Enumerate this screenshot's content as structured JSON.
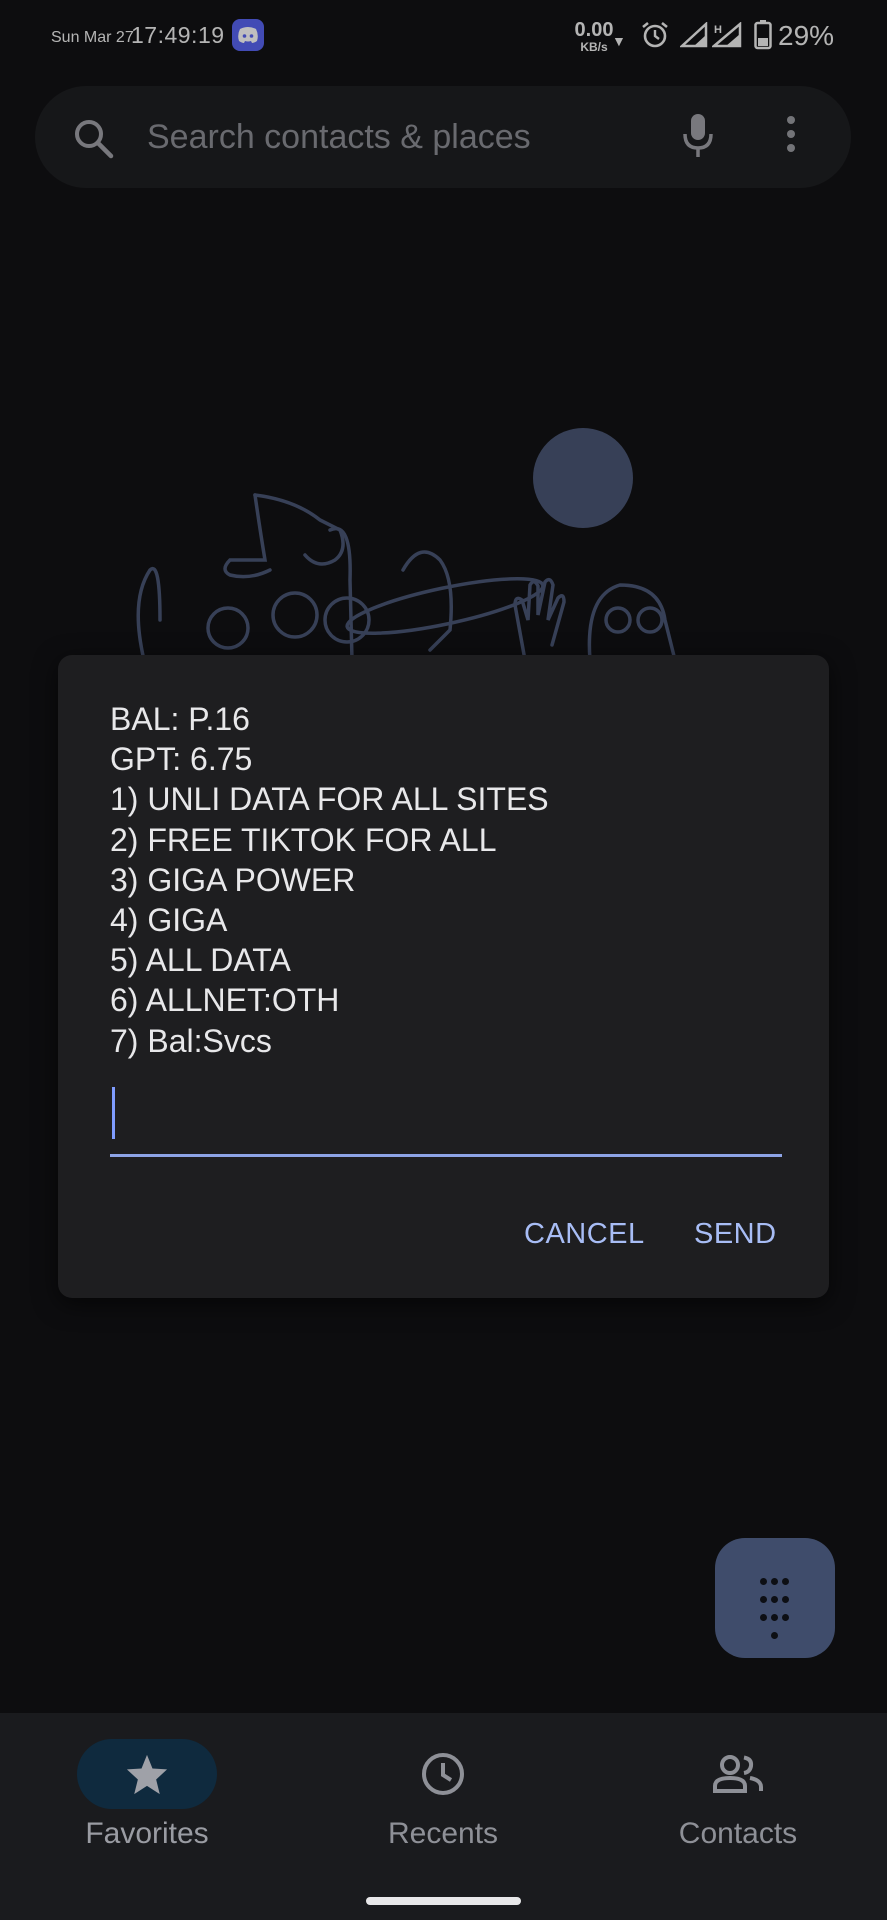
{
  "status_bar": {
    "date": "Sun Mar 27",
    "time": "17:49:19",
    "net_speed": "0.00",
    "net_speed_unit": "KB/s",
    "battery": "29%"
  },
  "search": {
    "placeholder": "Search contacts & places"
  },
  "ussd_dialog": {
    "lines": [
      "BAL: P.16",
      "GPT: 6.75",
      "1) UNLI DATA FOR ALL SITES",
      "2) FREE TIKTOK FOR ALL",
      "3) GIGA POWER",
      "4) GIGA",
      "5) ALL DATA",
      "6) ALLNET:OTH",
      "7) Bal:Svcs"
    ],
    "input_value": "",
    "cancel_label": "CANCEL",
    "send_label": "SEND"
  },
  "bottom_nav": {
    "items": [
      {
        "label": "Favorites",
        "icon": "star-icon",
        "active": true
      },
      {
        "label": "Recents",
        "icon": "clock-icon",
        "active": false
      },
      {
        "label": "Contacts",
        "icon": "people-icon",
        "active": false
      }
    ]
  },
  "colors": {
    "background": "#121214",
    "dialog": "#1e1e20",
    "accent": "#a8bdf5",
    "fab": "#3f4c6b",
    "nav_active_pill": "#0f2a3e"
  }
}
